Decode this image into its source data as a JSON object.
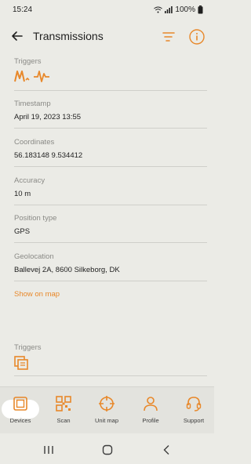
{
  "status_bar": {
    "time": "15:24",
    "battery": "100%"
  },
  "app_bar": {
    "title": "Transmissions"
  },
  "fields": [
    {
      "label": "Triggers",
      "value": ""
    },
    {
      "label": "Timestamp",
      "value": "April 19, 2023 13:55"
    },
    {
      "label": "Coordinates",
      "value": "56.183148 9.534412"
    },
    {
      "label": "Accuracy",
      "value": "10 m"
    },
    {
      "label": "Position type",
      "value": "GPS"
    },
    {
      "label": "Geolocation",
      "value": "Ballevej 2A, 8600 Silkeborg, DK"
    }
  ],
  "show_on_map": "Show on map",
  "second_entry": {
    "triggers_label": "Triggers"
  },
  "bottom_nav": [
    {
      "label": "Devices",
      "icon": "devices-icon"
    },
    {
      "label": "Scan",
      "icon": "qr-scan-icon"
    },
    {
      "label": "Unit map",
      "icon": "crosshair-map-icon"
    },
    {
      "label": "Profile",
      "icon": "person-icon"
    },
    {
      "label": "Support",
      "icon": "headset-icon"
    }
  ],
  "colors": {
    "accent": "#e8882a",
    "background": "#ebebe6"
  }
}
